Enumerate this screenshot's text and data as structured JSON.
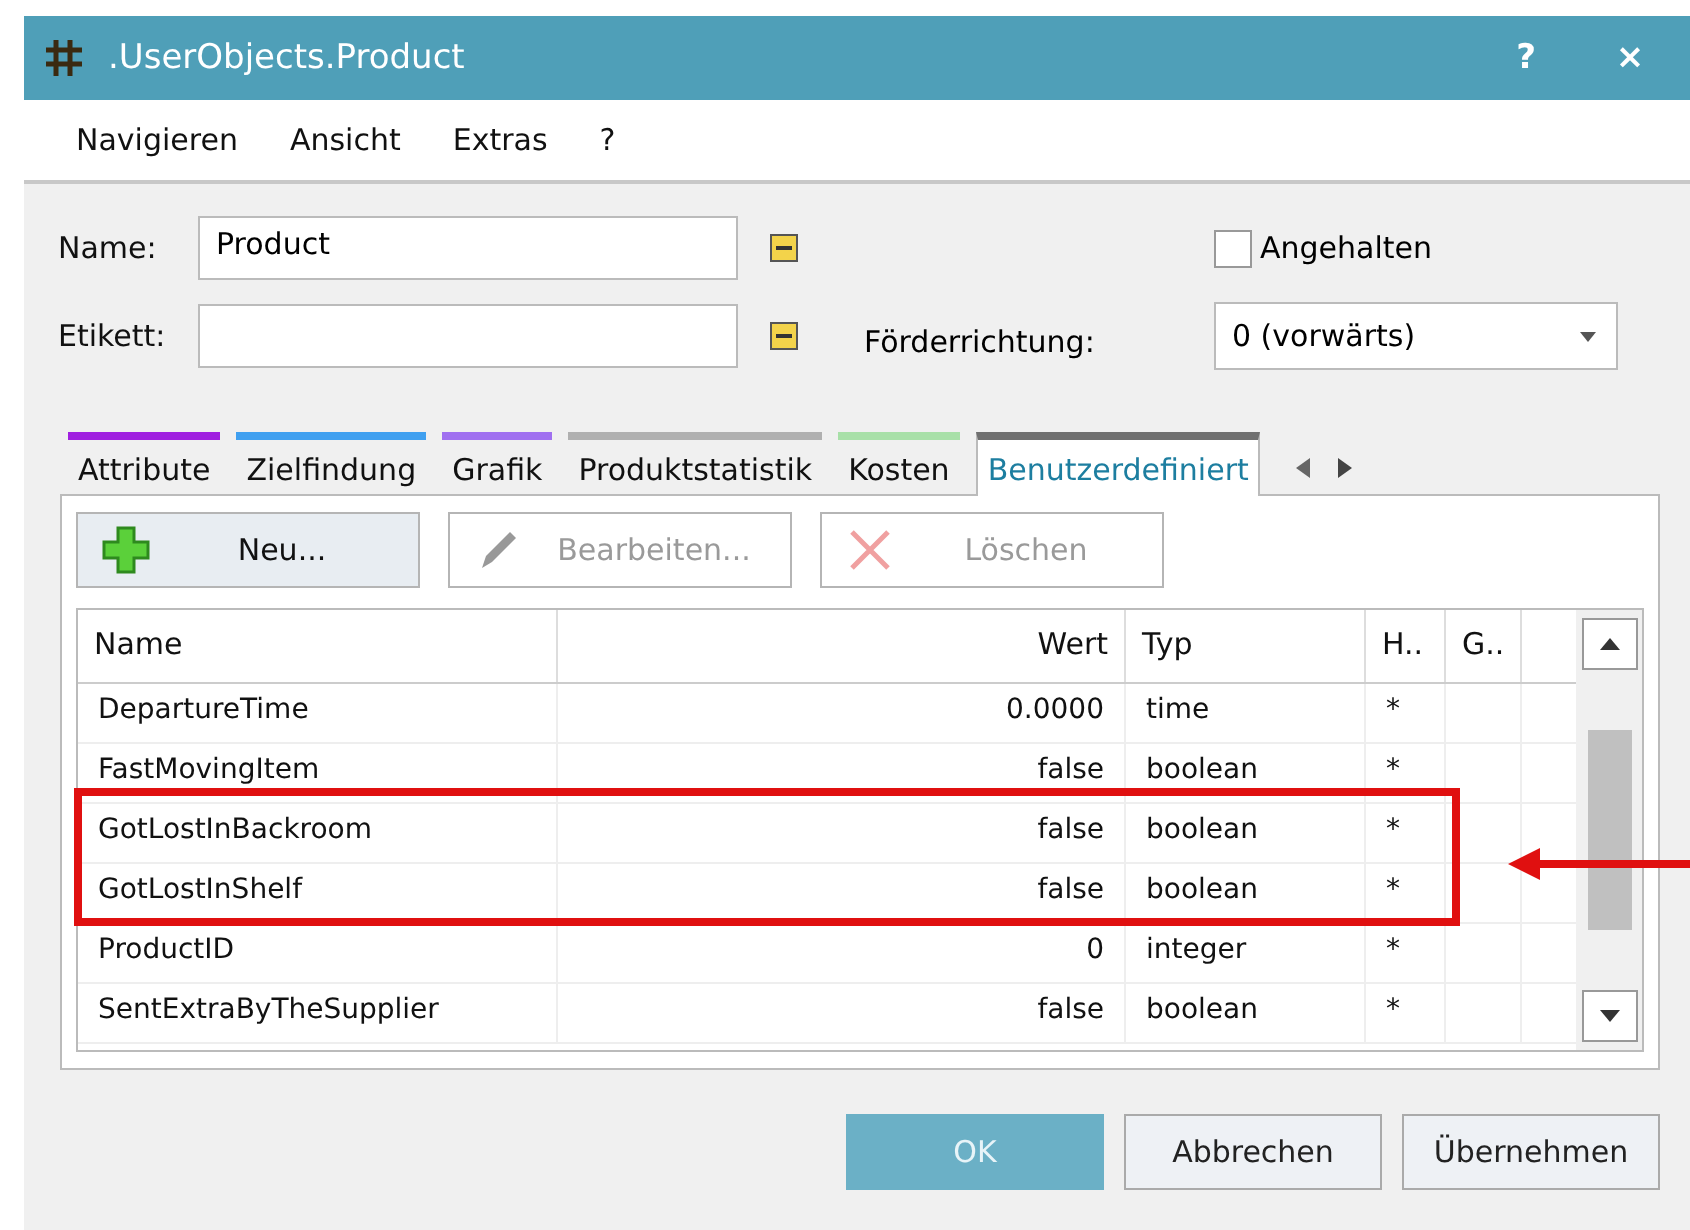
{
  "window": {
    "title": ".UserObjects.Product",
    "help": "?",
    "close": "×"
  },
  "menu": [
    "Navigieren",
    "Ansicht",
    "Extras",
    "?"
  ],
  "form": {
    "name_label": "Name:",
    "name_value": "Product",
    "label_label": "Etikett:",
    "paused": {
      "label": "Angehalten",
      "checked": false
    },
    "direction_label": "Förderrichtung:",
    "direction_value": "0 (vorwärts)"
  },
  "tabs": [
    {
      "label": "Attribute",
      "selected": false,
      "color": "#a020e0"
    },
    {
      "label": "Zielfindung",
      "selected": false,
      "color": "#40a0f0"
    },
    {
      "label": "Grafik",
      "selected": false,
      "color": "#a070f0"
    },
    {
      "label": "Produktstatistik",
      "selected": false,
      "color": "#b0b0b0"
    },
    {
      "label": "Kosten",
      "selected": false,
      "color": "#a8e0a8"
    },
    {
      "label": "Benutzerdefiniert",
      "selected": true,
      "color": "#707070"
    }
  ],
  "toolbar": [
    {
      "kind": "add",
      "label": "Neu...",
      "disabled": false
    },
    {
      "kind": "edit",
      "label": "Bearbeiten...",
      "disabled": true
    },
    {
      "kind": "delete",
      "label": "Löschen",
      "disabled": true
    }
  ],
  "table": {
    "columns": [
      "Name",
      "Wert",
      "Typ",
      "H..",
      "G.."
    ],
    "rows": [
      [
        "DepartureTime",
        "0.0000",
        "time",
        "*",
        ""
      ],
      [
        "FastMovingItem",
        "false",
        "boolean",
        "*",
        ""
      ],
      [
        "GotLostInBackroom",
        "false",
        "boolean",
        "*",
        ""
      ],
      [
        "GotLostInShelf",
        "false",
        "boolean",
        "*",
        ""
      ],
      [
        "ProductID",
        "0",
        "integer",
        "*",
        ""
      ],
      [
        "SentExtraByTheSupplier",
        "false",
        "boolean",
        "*",
        ""
      ]
    ]
  },
  "buttons": [
    {
      "label": "OK",
      "kind": "primary"
    },
    {
      "label": "Abbrechen",
      "kind": "normal"
    },
    {
      "label": "Übernehmen",
      "kind": "normal"
    }
  ]
}
